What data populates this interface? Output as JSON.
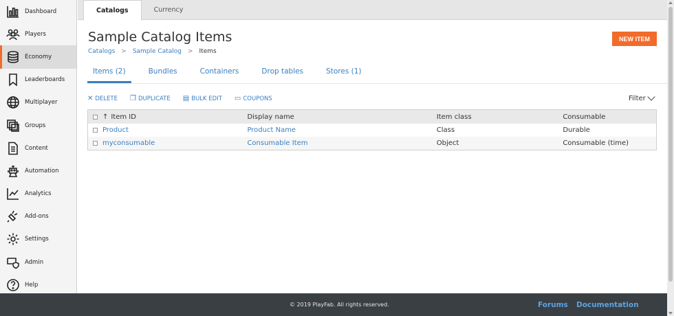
{
  "sidebar": {
    "items": [
      {
        "label": "Dashboard",
        "icon": "dashboard-icon"
      },
      {
        "label": "Players",
        "icon": "players-icon"
      },
      {
        "label": "Economy",
        "icon": "economy-icon",
        "active": true
      },
      {
        "label": "Leaderboards",
        "icon": "leaderboards-icon"
      },
      {
        "label": "Multiplayer",
        "icon": "globe-icon"
      },
      {
        "label": "Groups",
        "icon": "groups-icon"
      },
      {
        "label": "Content",
        "icon": "content-icon"
      },
      {
        "label": "Automation",
        "icon": "robot-icon"
      },
      {
        "label": "Analytics",
        "icon": "analytics-icon"
      },
      {
        "label": "Add-ons",
        "icon": "plug-icon"
      },
      {
        "label": "Settings",
        "icon": "gear-icon"
      },
      {
        "label": "Admin",
        "icon": "admin-shield-icon"
      },
      {
        "label": "Help",
        "icon": "help-icon"
      }
    ]
  },
  "top_tabs": [
    {
      "label": "Catalogs",
      "active": true
    },
    {
      "label": "Currency"
    }
  ],
  "header": {
    "title": "Sample Catalog Items",
    "breadcrumb": [
      "Catalogs",
      "Sample Catalog",
      "Items"
    ],
    "new_item_label": "NEW ITEM"
  },
  "subtabs": [
    {
      "label": "Items (2)",
      "active": true
    },
    {
      "label": "Bundles"
    },
    {
      "label": "Containers"
    },
    {
      "label": "Drop tables"
    },
    {
      "label": "Stores (1)"
    }
  ],
  "actions": [
    {
      "label": "DELETE",
      "icon": "close-icon"
    },
    {
      "label": "DUPLICATE",
      "icon": "duplicate-icon"
    },
    {
      "label": "BULK EDIT",
      "icon": "bulk-edit-icon"
    },
    {
      "label": "COUPONS",
      "icon": "coupon-icon"
    }
  ],
  "filter_label": "Filter",
  "table": {
    "columns": [
      "Item ID",
      "Display name",
      "Item class",
      "Consumable"
    ],
    "rows": [
      [
        "Product",
        "Product Name",
        "Class",
        "Durable"
      ],
      [
        "myconsumable",
        "Consumable Item",
        "Object",
        "Consumable (time)"
      ]
    ]
  },
  "footer": {
    "copyright": "© 2019 PlayFab. All rights reserved.",
    "links": [
      "Forums",
      "Documentation"
    ]
  },
  "colors": {
    "accent": "#f26b2a",
    "link": "#3a7fc1",
    "footer_bg": "#3a3f44"
  }
}
